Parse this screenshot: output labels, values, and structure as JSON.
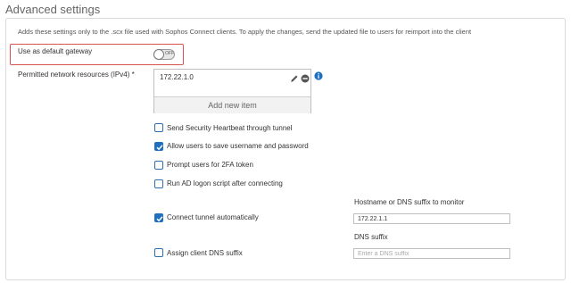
{
  "section": {
    "title": "Advanced settings"
  },
  "description": "Adds these settings only to the .scx file used with Sophos Connect clients. To apply the changes, send the updated file to users for reimport into the client",
  "default_gateway": {
    "label": "Use as default gateway",
    "toggle_state": "OFF"
  },
  "permitted_resources": {
    "label": "Permitted network resources (IPv4) *",
    "items": [
      "172.22.1.0"
    ],
    "add_label": "Add new item"
  },
  "options": [
    {
      "label": "Send Security Heartbeat through tunnel",
      "checked": false
    },
    {
      "label": "Allow users to save username and password",
      "checked": true
    },
    {
      "label": "Prompt users for 2FA token",
      "checked": false
    },
    {
      "label": "Run AD logon script after connecting",
      "checked": false
    },
    {
      "label": "Connect tunnel automatically",
      "checked": true
    },
    {
      "label": "Assign client DNS suffix",
      "checked": false
    }
  ],
  "monitor_host": {
    "label": "Hostname or DNS suffix to monitor",
    "value": "172.22.1.1"
  },
  "dns_suffix": {
    "label": "DNS suffix",
    "value": "",
    "placeholder": "Enter a DNS suffix"
  },
  "colors": {
    "accent": "#1f6fc1",
    "highlight": "#d9534f"
  }
}
